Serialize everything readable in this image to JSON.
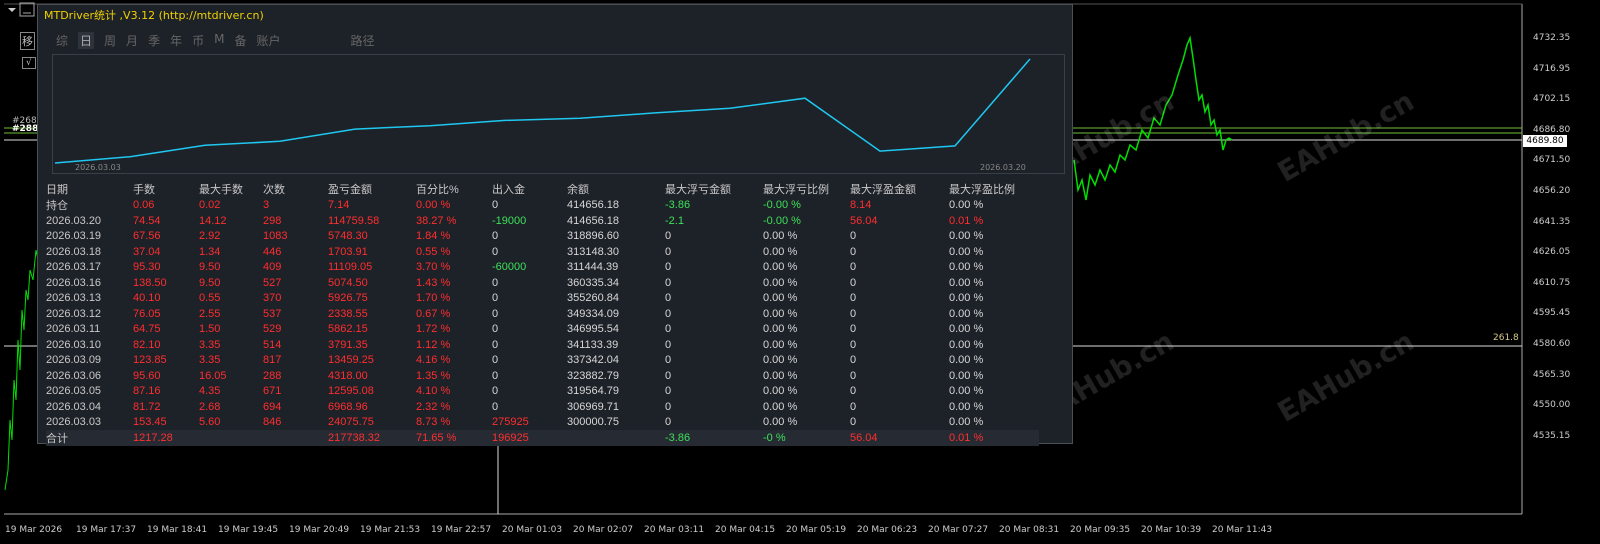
{
  "panel": {
    "title": "MTDriver统计 ,V3.12 (http://mtdriver.cn)",
    "tabs": [
      "综",
      "日",
      "周",
      "月",
      "季",
      "年",
      "币",
      "M",
      "备",
      "账户",
      "路径"
    ],
    "active_tab": "日"
  },
  "equity_chart": {
    "start_label": "2026.03.03",
    "end_label": "2026.03.20",
    "values": [
      300000.75,
      306969.71,
      319564.79,
      323882.79,
      337342.04,
      341133.39,
      346995.54,
      349334.09,
      355260.84,
      360335.34,
      371444.39,
      313148.3,
      318896.6,
      414656.18
    ]
  },
  "table": {
    "headers": [
      "日期",
      "手数",
      "最大手数",
      "次数",
      "盈亏金额",
      "百分比%",
      "出入金",
      "余额",
      "最大浮亏金额",
      "最大浮亏比例",
      "最大浮盈金额",
      "最大浮盈比例"
    ],
    "rows": [
      [
        "持仓",
        "0.06",
        "0.02",
        "3",
        "7.14",
        "0.00 %",
        "0",
        "414656.18",
        "-3.86",
        "-0.00 %",
        "8.14",
        "0.00 %"
      ],
      [
        "2026.03.20",
        "74.54",
        "14.12",
        "298",
        "114759.58",
        "38.27 %",
        "-19000",
        "414656.18",
        "-2.1",
        "-0.00 %",
        "56.04",
        "0.01 %"
      ],
      [
        "2026.03.19",
        "67.56",
        "2.92",
        "1083",
        "5748.30",
        "1.84 %",
        "0",
        "318896.60",
        "0",
        "0.00 %",
        "0",
        "0.00 %"
      ],
      [
        "2026.03.18",
        "37.04",
        "1.34",
        "446",
        "1703.91",
        "0.55 %",
        "0",
        "313148.30",
        "0",
        "0.00 %",
        "0",
        "0.00 %"
      ],
      [
        "2026.03.17",
        "95.30",
        "9.50",
        "409",
        "11109.05",
        "3.70 %",
        "-60000",
        "311444.39",
        "0",
        "0.00 %",
        "0",
        "0.00 %"
      ],
      [
        "2026.03.16",
        "138.50",
        "9.50",
        "527",
        "5074.50",
        "1.43 %",
        "0",
        "360335.34",
        "0",
        "0.00 %",
        "0",
        "0.00 %"
      ],
      [
        "2026.03.13",
        "40.10",
        "0.55",
        "370",
        "5926.75",
        "1.70 %",
        "0",
        "355260.84",
        "0",
        "0.00 %",
        "0",
        "0.00 %"
      ],
      [
        "2026.03.12",
        "76.05",
        "2.55",
        "537",
        "2338.55",
        "0.67 %",
        "0",
        "349334.09",
        "0",
        "0.00 %",
        "0",
        "0.00 %"
      ],
      [
        "2026.03.11",
        "64.75",
        "1.50",
        "529",
        "5862.15",
        "1.72 %",
        "0",
        "346995.54",
        "0",
        "0.00 %",
        "0",
        "0.00 %"
      ],
      [
        "2026.03.10",
        "82.10",
        "3.35",
        "514",
        "3791.35",
        "1.12 %",
        "0",
        "341133.39",
        "0",
        "0.00 %",
        "0",
        "0.00 %"
      ],
      [
        "2026.03.09",
        "123.85",
        "3.35",
        "817",
        "13459.25",
        "4.16 %",
        "0",
        "337342.04",
        "0",
        "0.00 %",
        "0",
        "0.00 %"
      ],
      [
        "2026.03.06",
        "95.60",
        "16.05",
        "288",
        "4318.00",
        "1.35 %",
        "0",
        "323882.79",
        "0",
        "0.00 %",
        "0",
        "0.00 %"
      ],
      [
        "2026.03.05",
        "87.16",
        "4.35",
        "671",
        "12595.08",
        "4.10 %",
        "0",
        "319564.79",
        "0",
        "0.00 %",
        "0",
        "0.00 %"
      ],
      [
        "2026.03.04",
        "81.72",
        "2.68",
        "694",
        "6968.96",
        "2.32 %",
        "0",
        "306969.71",
        "0",
        "0.00 %",
        "0",
        "0.00 %"
      ],
      [
        "2026.03.03",
        "153.45",
        "5.60",
        "846",
        "24075.75",
        "8.73 %",
        "275925",
        "300000.75",
        "0",
        "0.00 %",
        "0",
        "0.00 %"
      ]
    ],
    "total": [
      "合计",
      "1217.28",
      "",
      "",
      "217738.32",
      "71.65 %",
      "196925",
      "",
      "-3.86",
      "-0 %",
      "56.04",
      "0.01 %"
    ]
  },
  "price_axis": [
    "4732.35",
    "4716.95",
    "4702.15",
    "4686.80",
    "4671.50",
    "4656.20",
    "4641.35",
    "4626.05",
    "4610.75",
    "4595.45",
    "4580.60",
    "4565.30",
    "4550.00",
    "4535.15"
  ],
  "current_price": "4689.80",
  "level_label": "261.8",
  "left_labels": {
    "box": "移",
    "small": "√",
    "level1": "#268",
    "level2": "#288"
  },
  "time_axis": [
    "19 Mar 2026",
    "19 Mar 17:37",
    "19 Mar 18:41",
    "19 Mar 19:45",
    "19 Mar 20:49",
    "19 Mar 21:53",
    "19 Mar 22:57",
    "20 Mar 01:03",
    "20 Mar 02:07",
    "20 Mar 03:11",
    "20 Mar 04:15",
    "20 Mar 05:19",
    "20 Mar 06:23",
    "20 Mar 07:27",
    "20 Mar 08:31",
    "20 Mar 09:35",
    "20 Mar 10:39",
    "20 Mar 11:43"
  ],
  "watermark": "EAHub.cn",
  "colors": {
    "price_line": "#00e000",
    "equity_line": "#1ec8f0",
    "loss": "#ff2e2e",
    "gain": "#3ee05a",
    "level_line": "#6fbf3a"
  }
}
